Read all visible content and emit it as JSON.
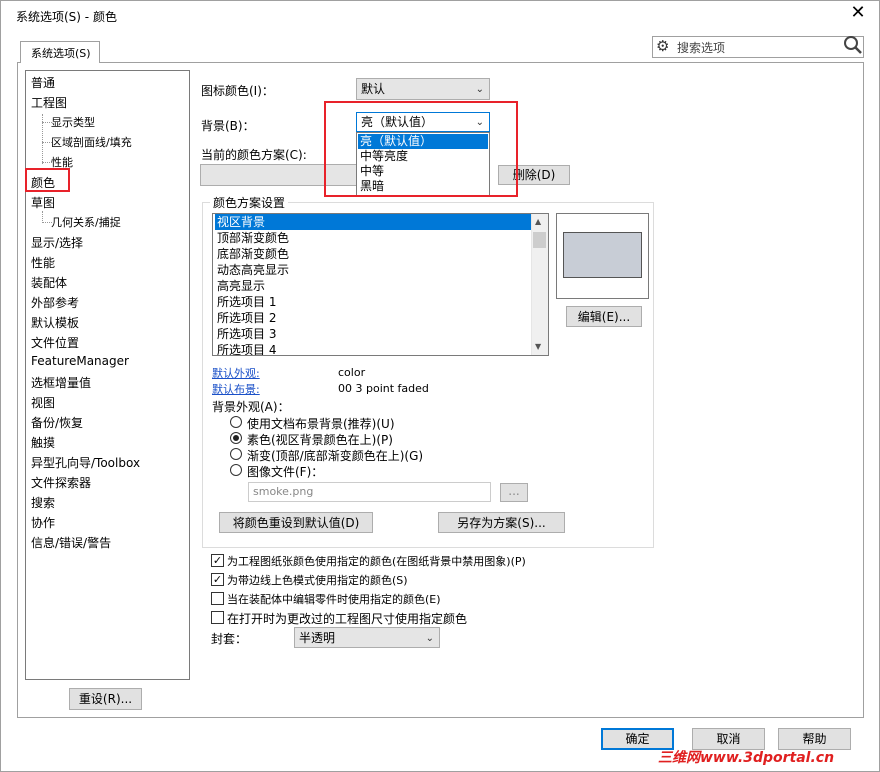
{
  "window": {
    "title": "系统选项(S) - 颜色"
  },
  "tab": {
    "label": "系统选项(S)"
  },
  "search": {
    "placeholder": "搜索选项"
  },
  "tree": {
    "items": [
      "普通",
      "工程图",
      "显示类型",
      "区域剖面线/填充",
      "性能",
      "颜色",
      "草图",
      "几何关系/捕捉",
      "显示/选择",
      "性能",
      "装配体",
      "外部参考",
      "默认模板",
      "文件位置",
      "FeatureManager",
      "选框增量值",
      "视图",
      "备份/恢复",
      "触摸",
      "异型孔向导/Toolbox",
      "文件探索器",
      "搜索",
      "协作",
      "信息/错误/警告"
    ]
  },
  "reset_button": "重设(R)...",
  "icon_color": {
    "label": "图标颜色(I)：",
    "value": "默认"
  },
  "background": {
    "label": "背景(B)：",
    "value": "亮（默认值）",
    "options": [
      "亮（默认值）",
      "中等亮度",
      "中等",
      "黑暗"
    ]
  },
  "scheme": {
    "label": "当前的颜色方案(C):",
    "delete_button": "删除(D)"
  },
  "color_settings": {
    "title": "颜色方案设置",
    "items": [
      "视区背景",
      "顶部渐变颜色",
      "底部渐变颜色",
      "动态高亮显示",
      "高亮显示",
      "所选项目 1",
      "所选项目 2",
      "所选项目 3",
      "所选项目 4"
    ],
    "edit_button": "编辑(E)...",
    "default_appearance_label": "默认外观:",
    "default_appearance_value": "color",
    "default_scene_label": "默认布景:",
    "default_scene_value": "00 3 point faded",
    "bg_appearance_label": "背景外观(A)：",
    "radios": [
      "使用文档布景背景(推荐)(U)",
      "素色(视区背景颜色在上)(P)",
      "渐变(顶部/底部渐变颜色在上)(G)",
      "图像文件(F)："
    ],
    "image_file": "smoke.png",
    "browse_button": "...",
    "reset_colors_button": "将颜色重设到默认值(D)",
    "save_scheme_button": "另存为方案(S)..."
  },
  "checkboxes": [
    "为工程图纸张颜色使用指定的颜色(在图纸背景中禁用图象)(P)",
    "为带边线上色模式使用指定的颜色(S)",
    "当在装配体中编辑零件时使用指定的颜色(E)",
    "在打开时为更改过的工程图尺寸使用指定颜色"
  ],
  "envelope": {
    "label": "封套：",
    "value": "半透明"
  },
  "footer": {
    "ok": "确定",
    "cancel": "取消",
    "help": "帮助"
  },
  "watermark": "三维网www.3dportal.cn"
}
